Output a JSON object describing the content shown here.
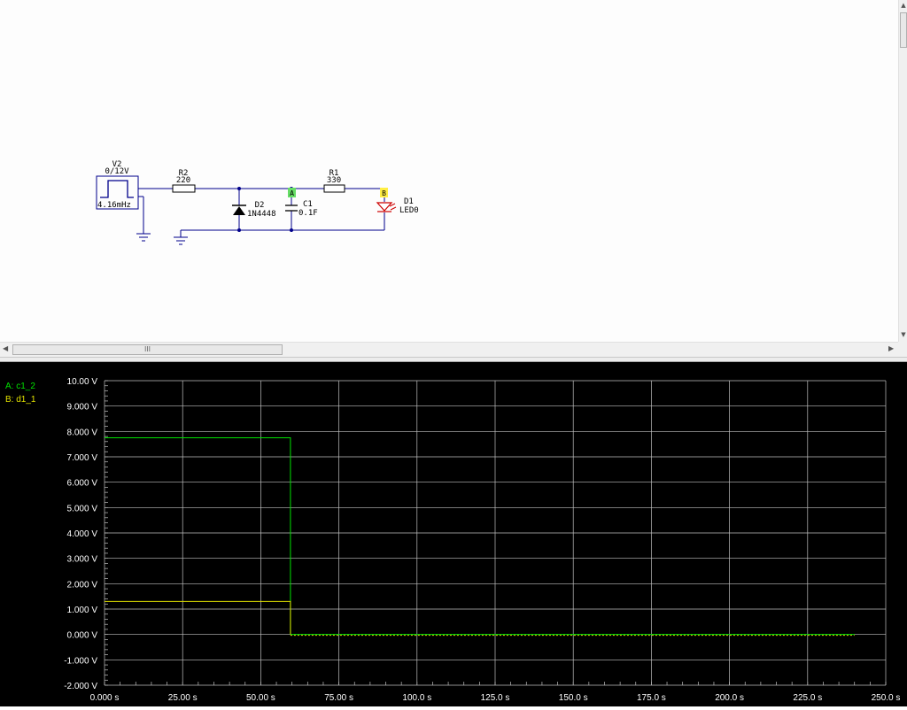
{
  "schematic": {
    "components": {
      "v2": {
        "name": "V2",
        "value": "0/12V",
        "freq": "4.16mHz"
      },
      "r2": {
        "name": "R2",
        "value": "220"
      },
      "d2": {
        "name": "D2",
        "value": "1N4448"
      },
      "c1": {
        "name": "C1",
        "value": "0.1F"
      },
      "r1": {
        "name": "R1",
        "value": "330"
      },
      "d1": {
        "name": "D1",
        "value": "LED0"
      }
    },
    "probes": {
      "a": "A",
      "b": "B"
    },
    "colors": {
      "wire": "#00008b",
      "probe_a": "#66dd66",
      "probe_b": "#ffee44",
      "led": "#cc0000"
    }
  },
  "scrollbar": {
    "grip": "III"
  },
  "scope": {
    "legend": [
      {
        "label": "A: c1_2",
        "color": "#00e000"
      },
      {
        "label": "B: d1_1",
        "color": "#e0e000"
      }
    ],
    "colors": {
      "background": "#000000",
      "grid": "#c0c0c0",
      "axis_text": "#ffffff"
    }
  },
  "chart_data": {
    "type": "line",
    "xlim": [
      0,
      250
    ],
    "ylim": [
      -2,
      10
    ],
    "x_ticks": [
      0,
      25,
      50,
      75,
      100,
      125,
      150,
      175,
      200,
      225,
      250
    ],
    "x_tick_labels": [
      "0.000 s",
      "25.00 s",
      "50.00 s",
      "75.00 s",
      "100.0 s",
      "125.0 s",
      "150.0 s",
      "175.0 s",
      "200.0 s",
      "225.0 s",
      "250.0 s"
    ],
    "y_ticks": [
      10,
      9,
      8,
      7,
      6,
      5,
      4,
      3,
      2,
      1,
      0,
      -1,
      -2
    ],
    "y_tick_labels": [
      "10.00 V",
      "9.000 V",
      "8.000 V",
      "7.000 V",
      "6.000 V",
      "5.000 V",
      "4.000 V",
      "3.000 V",
      "2.000 V",
      "1.000 V",
      "0.000 V",
      "-1.000 V",
      "-2.000 V"
    ],
    "grid": true,
    "series": [
      {
        "name": "A: c1_2",
        "color": "#00e000",
        "x": [
          0,
          59.5,
          59.5,
          240
        ],
        "y": [
          7.75,
          7.75,
          0,
          0
        ]
      },
      {
        "name": "B: d1_1",
        "color": "#e0e000",
        "x": [
          0,
          59.5,
          59.5,
          240
        ],
        "y": [
          1.3,
          1.3,
          0,
          0
        ],
        "dashed_after_x": 59.5
      }
    ]
  }
}
